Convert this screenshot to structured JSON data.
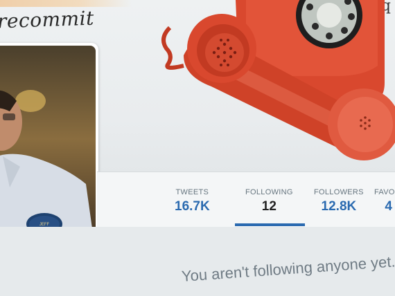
{
  "header": {
    "brand_text": "recommit",
    "corner_glyph": "q"
  },
  "profile": {
    "avatar_icon": "avatar",
    "badge_text": "JEFF"
  },
  "nav": {
    "tabs": [
      {
        "label": "TWEETS",
        "count": "16.7K"
      },
      {
        "label": "FOLLOWING",
        "count": "12",
        "active": true
      },
      {
        "label": "FOLLOWERS",
        "count": "12.8K"
      },
      {
        "label": "FAVORI",
        "count": "4"
      }
    ]
  },
  "main": {
    "empty_message": "You aren't following anyone yet."
  },
  "colors": {
    "accent": "#2a6ab0",
    "phone": "#d9482e"
  }
}
